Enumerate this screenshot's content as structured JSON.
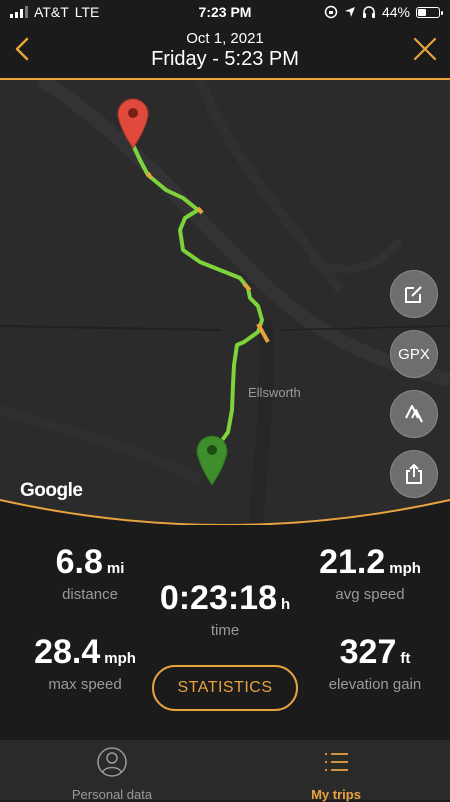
{
  "status_bar": {
    "carrier": "AT&T",
    "network": "LTE",
    "time": "7:23 PM",
    "battery": "44%",
    "battery_level": 0.44
  },
  "header": {
    "date": "Oct 1, 2021",
    "subtitle": "Friday - 5:23 PM"
  },
  "map": {
    "city_label": "Ellsworth",
    "attribution": "Google",
    "gpx_label": "GPX"
  },
  "stats": {
    "distance": {
      "value": "6.8",
      "unit": "mi",
      "label": "distance"
    },
    "avg_speed": {
      "value": "21.2",
      "unit": "mph",
      "label": "avg speed"
    },
    "time": {
      "value": "0:23:18",
      "unit": "h",
      "label": "time"
    },
    "max_speed": {
      "value": "28.4",
      "unit": "mph",
      "label": "max speed"
    },
    "elevation": {
      "value": "327",
      "unit": "ft",
      "label": "elevation gain"
    },
    "button_label": "STATISTICS"
  },
  "tabs": {
    "personal": "Personal data",
    "trips": "My trips"
  },
  "colors": {
    "accent": "#e8a33d",
    "route": "#7ed23a",
    "start_pin": "#3e8e2e",
    "end_pin": "#e04a3c"
  }
}
